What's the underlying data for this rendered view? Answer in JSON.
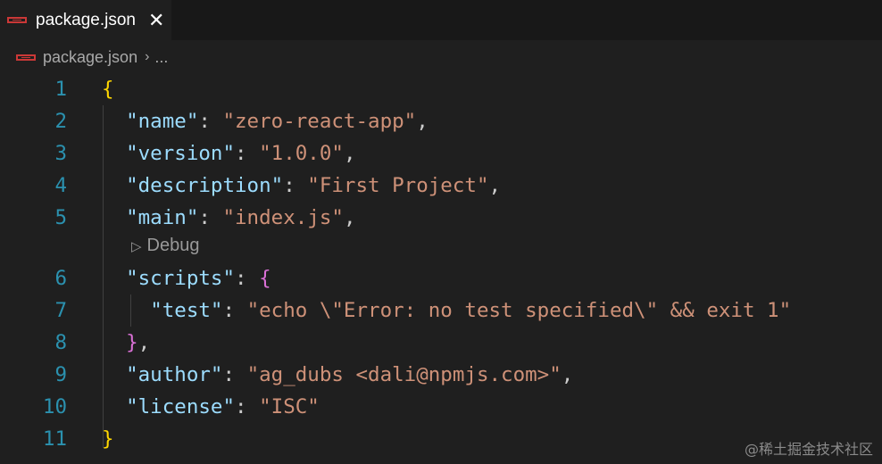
{
  "tab": {
    "label": "package.json",
    "close": "✕"
  },
  "breadcrumb": {
    "file": "package.json",
    "separator": "›",
    "more": "..."
  },
  "editor": {
    "codelens": "Debug",
    "lines": [
      {
        "n": "1",
        "tokens": [
          [
            "b1",
            "{"
          ]
        ]
      },
      {
        "n": "2",
        "tokens": [
          [
            "p",
            "  "
          ],
          [
            "k",
            "\"name\""
          ],
          [
            "p",
            ": "
          ],
          [
            "s",
            "\"zero-react-app\""
          ],
          [
            "p",
            ","
          ]
        ]
      },
      {
        "n": "3",
        "tokens": [
          [
            "p",
            "  "
          ],
          [
            "k",
            "\"version\""
          ],
          [
            "p",
            ": "
          ],
          [
            "s",
            "\"1.0.0\""
          ],
          [
            "p",
            ","
          ]
        ]
      },
      {
        "n": "4",
        "tokens": [
          [
            "p",
            "  "
          ],
          [
            "k",
            "\"description\""
          ],
          [
            "p",
            ": "
          ],
          [
            "s",
            "\"First Project\""
          ],
          [
            "p",
            ","
          ]
        ]
      },
      {
        "n": "5",
        "tokens": [
          [
            "p",
            "  "
          ],
          [
            "k",
            "\"main\""
          ],
          [
            "p",
            ": "
          ],
          [
            "s",
            "\"index.js\""
          ],
          [
            "p",
            ","
          ]
        ]
      },
      {
        "n": "6",
        "tokens": [
          [
            "p",
            "  "
          ],
          [
            "k",
            "\"scripts\""
          ],
          [
            "p",
            ": "
          ],
          [
            "b2",
            "{"
          ]
        ]
      },
      {
        "n": "7",
        "tokens": [
          [
            "p",
            "    "
          ],
          [
            "k",
            "\"test\""
          ],
          [
            "p",
            ": "
          ],
          [
            "s",
            "\"echo \\\"Error: no test specified\\\" && exit 1\""
          ]
        ]
      },
      {
        "n": "8",
        "tokens": [
          [
            "p",
            "  "
          ],
          [
            "b2",
            "}"
          ],
          [
            "p",
            ","
          ]
        ]
      },
      {
        "n": "9",
        "tokens": [
          [
            "p",
            "  "
          ],
          [
            "k",
            "\"author\""
          ],
          [
            "p",
            ": "
          ],
          [
            "s",
            "\"ag_dubs <dali@npmjs.com>\""
          ],
          [
            "p",
            ","
          ]
        ]
      },
      {
        "n": "10",
        "tokens": [
          [
            "p",
            "  "
          ],
          [
            "k",
            "\"license\""
          ],
          [
            "p",
            ": "
          ],
          [
            "s",
            "\"ISC\""
          ]
        ]
      },
      {
        "n": "11",
        "tokens": [
          [
            "b1",
            "}"
          ]
        ]
      }
    ]
  },
  "watermark": "@稀土掘金技术社区",
  "colors": {
    "key": "#9cdcfe",
    "string": "#ce9178",
    "line_number": "#2b91af",
    "bracket_outer": "#ffd700",
    "bracket_inner": "#da70d6",
    "npm": "#cb3837"
  },
  "icons": {
    "file_icon": "npm-icon",
    "codelens_icon": "play-icon"
  }
}
